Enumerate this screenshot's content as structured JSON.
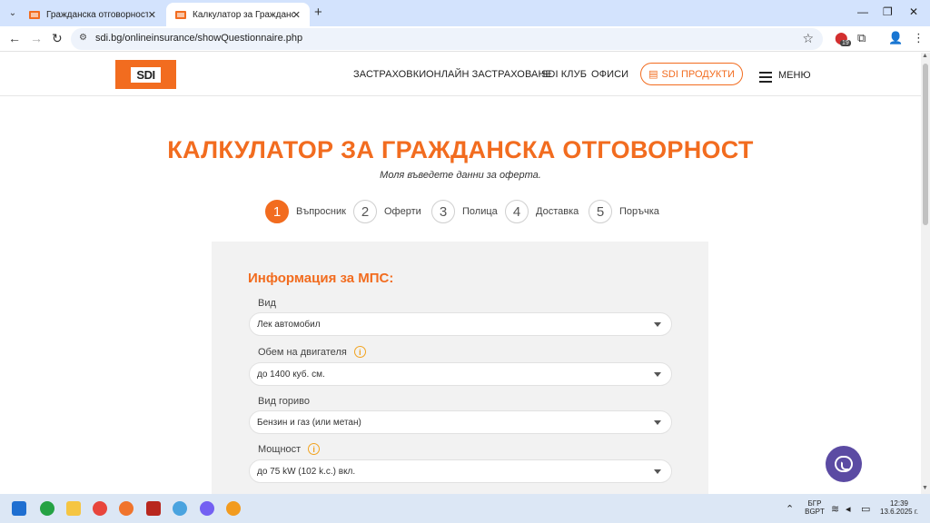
{
  "browser": {
    "tabs": [
      {
        "title": "Гражданска отговорност - Це"
      },
      {
        "title": "Калкулатор за Гражданска От"
      }
    ],
    "url": "sdi.bg/onlineinsurance/showQuestionnaire.php",
    "extension_badge": "19"
  },
  "site": {
    "logo_text": "SDI",
    "menu": [
      "ЗАСТРАХОВКИ",
      "ОНЛАЙН ЗАСТРАХОВАНЕ",
      "SDI КЛУБ",
      "ОФИСИ"
    ],
    "products_button": "SDI ПРОДУКТИ",
    "menu_label": "МЕНЮ"
  },
  "main": {
    "title": "КАЛКУЛАТОР ЗА ГРАЖДАНСКА ОТГОВОРНОСТ",
    "subtitle": "Моля въведете данни за оферта.",
    "steps": [
      {
        "num": "1",
        "label": "Въпросник",
        "active": true
      },
      {
        "num": "2",
        "label": "Оферти"
      },
      {
        "num": "3",
        "label": "Полица"
      },
      {
        "num": "4",
        "label": "Доставка"
      },
      {
        "num": "5",
        "label": "Поръчка"
      }
    ],
    "section_title": "Информация за МПС:",
    "fields": [
      {
        "label": "Вид",
        "value": "Лек автомобил",
        "info": false
      },
      {
        "label": "Обем на двигателя",
        "value": "до 1400 куб. см.",
        "info": true
      },
      {
        "label": "Вид гориво",
        "value": "Бензин и газ (или метан)",
        "info": false
      },
      {
        "label": "Мощност",
        "value": "до 75 kW (102 k.c.) вкл.",
        "info": true
      }
    ]
  },
  "taskbar": {
    "lang_top": "БГР",
    "lang_bottom": "BGPT",
    "time": "12:39",
    "date": "13.6.2025 г."
  },
  "colors": {
    "accent": "#f26c1f",
    "panel": "#f2f2f2",
    "viber": "#5b4ba3"
  }
}
